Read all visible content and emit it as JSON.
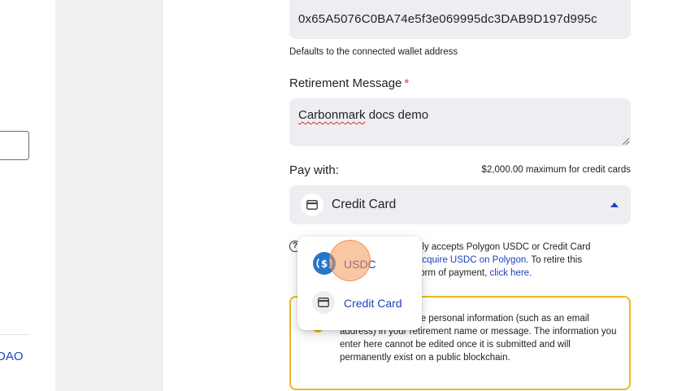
{
  "left": {
    "link_text": "DAO"
  },
  "form": {
    "beneficiary_address": "0x65A5076C0BA74e5f3e069995dc3DAB9D197d995c",
    "address_help": "Defaults to the connected wallet address",
    "retirement_message_label": "Retirement Message",
    "required_marker": "*",
    "retirement_message_prefix": "Carbonmark",
    "retirement_message_rest": " docs demo",
    "pay_with_label": "Pay with:",
    "pay_max_note": "$2,000.00 maximum for credit cards",
    "pay_selected": "Credit Card"
  },
  "info": {
    "text_a": "nly accepts Polygon USDC or Credit Card",
    "link_acquire": "acquire USDC on Polygon",
    "text_b": ". To retire this",
    "text_c": "form of payment, ",
    "link_click": "click here",
    "text_d": "."
  },
  "warning": {
    "text": "include any sensitive personal information (such as an email address) in your retirement name or message. The information you enter here cannot be edited once it is submitted and will permanently exist on a public blockchain."
  },
  "dropdown": {
    "options": [
      {
        "label": "USDC",
        "icon": "usdc-coin-icon"
      },
      {
        "label": "Credit Card",
        "icon": "credit-card-icon"
      }
    ]
  },
  "colors": {
    "accent": "#1d3fbf",
    "warning_border": "#f1b71c",
    "field_bg": "#eeeef2",
    "required": "#e2343f",
    "usdc_blue": "#2775ca"
  }
}
